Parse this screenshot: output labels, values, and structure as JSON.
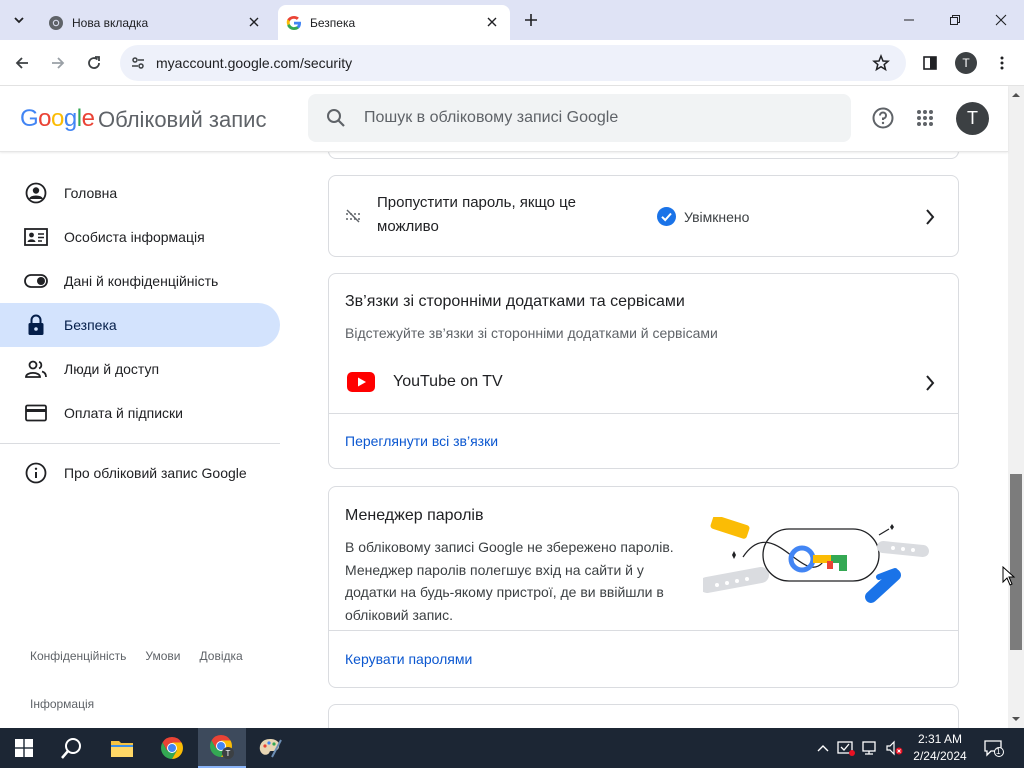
{
  "browser": {
    "tabs": [
      {
        "title": "Нова вкладка",
        "active": false
      },
      {
        "title": "Безпека",
        "active": true
      }
    ],
    "url": "myaccount.google.com/security",
    "profile_initial": "T"
  },
  "header": {
    "logo": [
      "G",
      "o",
      "o",
      "g",
      "l",
      "e"
    ],
    "logo_colors": [
      "#4285f4",
      "#ea4335",
      "#fbbc05",
      "#4285f4",
      "#34a853",
      "#ea4335"
    ],
    "account_label": "Обліковий запис",
    "search_placeholder": "Пошук в обліковому записі Google",
    "avatar_initial": "T"
  },
  "sidebar": {
    "items": [
      {
        "label": "Головна",
        "icon": "account-circle-icon"
      },
      {
        "label": "Особиста інформація",
        "icon": "id-card-icon"
      },
      {
        "label": "Дані й конфіденційність",
        "icon": "toggle-icon"
      },
      {
        "label": "Безпека",
        "icon": "lock-icon",
        "active": true
      },
      {
        "label": "Люди й доступ",
        "icon": "people-icon"
      },
      {
        "label": "Оплата й підписки",
        "icon": "credit-card-icon"
      }
    ],
    "about": "Про обліковий запис Google",
    "footer": [
      "Конфіденційність",
      "Умови",
      "Довідка"
    ],
    "footer_info": "Інформація"
  },
  "main": {
    "skip_password": {
      "label": "Пропустити пароль, якщо це можливо",
      "status": "Увімкнено"
    },
    "third_party": {
      "title": "Зв’язки зі сторонніми додатками та сервісами",
      "subtitle": "Відстежуйте зв’язки зі сторонніми додатками й сервісами",
      "app": "YouTube on TV",
      "link": "Переглянути всі зв’язки"
    },
    "password_manager": {
      "title": "Менеджер паролів",
      "body": "В обліковому записі Google не збережено паролів. Менеджер паролів полегшує вхід на сайти й у додатки на будь-якому пристрої, де ви ввійшли в обліковий запис.",
      "link": "Керувати паролями"
    }
  },
  "taskbar": {
    "time": "2:31 AM",
    "date": "2/24/2024",
    "notifications": "1"
  },
  "colors": {
    "accent": "#0b57d0",
    "active_nav": "#d3e3fd",
    "tabstrip": "#dfe3f5",
    "check_blue": "#1a73e8",
    "youtube_red": "#ff0000"
  }
}
